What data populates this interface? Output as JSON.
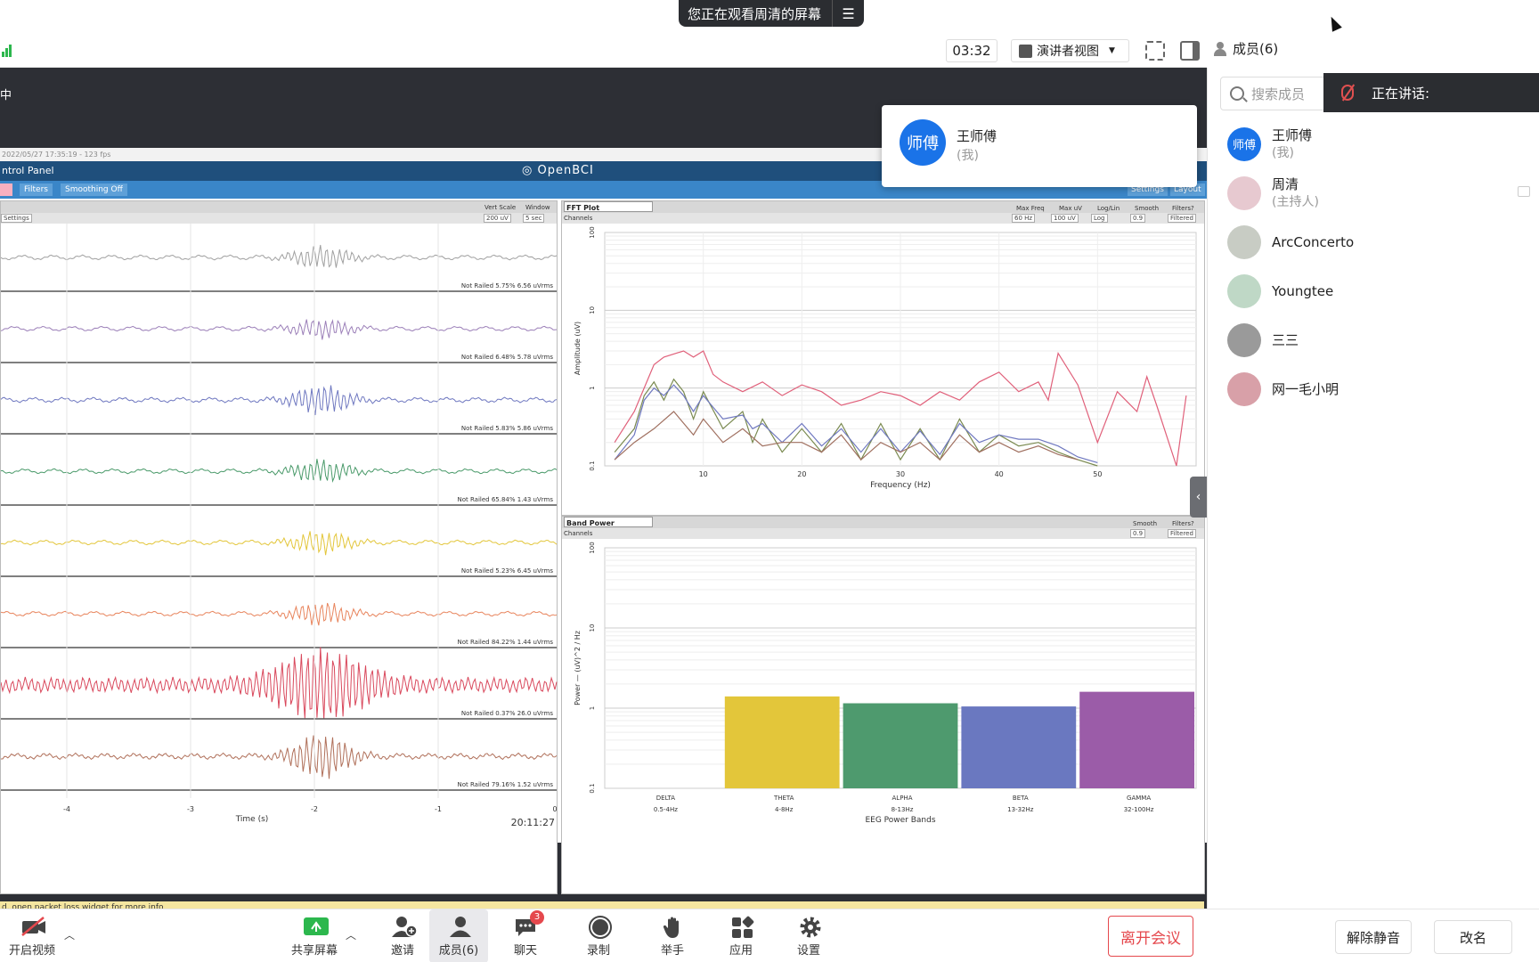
{
  "banner": {
    "text": "您正在观看周清的屏幕",
    "menu_icon": "menu-lines-icon"
  },
  "toolbar": {
    "timer": "03:32",
    "view_mode": "演讲者视图",
    "members_label": "成员(6)"
  },
  "share": {
    "cut_text": "中"
  },
  "openbci": {
    "date_text": "2022/05/27 17:35:19 - 123 fps",
    "header_left": "ntrol Panel",
    "logo": "OpenBCI",
    "buttons": [
      "Filters",
      "Smoothing Off"
    ],
    "right_buttons": [
      "Settings",
      "Layout"
    ],
    "ts_controls": {
      "settings": "Settings",
      "vert_scale_label": "Vert Scale",
      "vert_scale": "200 uV",
      "window_label": "Window",
      "window": "5 sec"
    },
    "ts_channels": [
      {
        "status": "Not Railed 5.75% 6.56 uVrms",
        "color": "#a0a0a0",
        "amp": 0.35
      },
      {
        "status": "Not Railed 6.48% 5.78 uVrms",
        "color": "#9b7fb8",
        "amp": 0.3
      },
      {
        "status": "Not Railed 5.83% 5.86 uVrms",
        "color": "#6f78c0",
        "amp": 0.45
      },
      {
        "status": "Not Railed 65.84% 1.43 uVrms",
        "color": "#4a9a6a",
        "amp": 0.35
      },
      {
        "status": "Not Railed 5.23% 6.45 uVrms",
        "color": "#e3c63a",
        "amp": 0.35
      },
      {
        "status": "Not Railed 84.22% 1.44 uVrms",
        "color": "#e8845c",
        "amp": 0.35
      },
      {
        "status": "Not Railed 0.37% 26.0 uVrms",
        "color": "#d9485c",
        "amp": 1.0
      },
      {
        "status": "Not Railed 79.16% 1.52 uVrms",
        "color": "#b0705a",
        "amp": 0.7
      }
    ],
    "ts_xticks": [
      "-4",
      "-3",
      "-2",
      "-1",
      "0"
    ],
    "ts_xlabel": "Time (s)",
    "ts_clock": "20:11:27",
    "fft_tab": "FFT Plot",
    "channels_label": "Channels",
    "fft_controls": [
      "60 Hz",
      "100 uV",
      "Log",
      "0.9",
      "Filtered"
    ],
    "fft_control_labels": [
      "Max Freq",
      "Max uV",
      "Log/Lin",
      "Smooth",
      "Filters?"
    ],
    "fft_ylabel": "Amplitude (uV)",
    "fft_xlabel": "Frequency (Hz)",
    "fft_yticks": [
      "100",
      "10",
      "1",
      "0.1"
    ],
    "fft_xticks": [
      "10",
      "20",
      "30",
      "40",
      "50"
    ],
    "bp_tab": "Band Power",
    "bp_controls": [
      "0.9",
      "Filtered"
    ],
    "bp_control_labels": [
      "Smooth",
      "Filters?"
    ],
    "bp_ylabel": "Power — (uV)^2 / Hz",
    "bp_xlabel": "EEG Power Bands",
    "bp_yticks": [
      "100",
      "10",
      "1",
      "0.1"
    ],
    "status_text": "d, open packet loss widget for more info"
  },
  "chart_data": [
    {
      "type": "line",
      "title": "FFT Plot",
      "xlabel": "Frequency (Hz)",
      "ylabel": "Amplitude (uV)",
      "xlim": [
        0,
        60
      ],
      "ylim": [
        0.1,
        100
      ],
      "log_y": true,
      "series": [
        {
          "color": "#e0607a",
          "x": [
            1,
            3,
            5,
            6,
            8,
            9,
            10,
            11,
            12,
            14,
            16,
            18,
            20,
            22,
            24,
            26,
            28,
            30,
            32,
            34,
            36,
            38,
            40,
            42,
            44,
            45,
            46,
            48,
            50,
            52,
            54,
            55,
            56,
            58,
            59
          ],
          "y": [
            0.2,
            0.5,
            2,
            2.5,
            3,
            2.5,
            3,
            1.5,
            1.2,
            0.9,
            1.2,
            0.8,
            1.1,
            0.9,
            0.6,
            0.7,
            0.9,
            0.8,
            0.6,
            0.9,
            0.7,
            1.2,
            1.6,
            0.9,
            1.2,
            0.7,
            2.8,
            1.1,
            0.2,
            0.9,
            0.5,
            1.4,
            0.6,
            0.1,
            0.8
          ]
        },
        {
          "color": "#7a8a50",
          "x": [
            1,
            3,
            4,
            5,
            6,
            7,
            8,
            9,
            10,
            12,
            14,
            15,
            16,
            18,
            20,
            22,
            24,
            26,
            28,
            30,
            32,
            34,
            36,
            38,
            40,
            42,
            44,
            46,
            48,
            50
          ],
          "y": [
            0.15,
            0.3,
            0.8,
            1.2,
            0.7,
            1.3,
            0.9,
            0.4,
            0.9,
            0.3,
            0.5,
            0.2,
            0.4,
            0.15,
            0.3,
            0.15,
            0.35,
            0.12,
            0.35,
            0.12,
            0.3,
            0.12,
            0.4,
            0.15,
            0.25,
            0.18,
            0.2,
            0.15,
            0.12,
            0.1
          ]
        },
        {
          "color": "#6f78c0",
          "x": [
            1,
            3,
            4,
            5,
            6,
            7,
            8,
            9,
            10,
            12,
            14,
            15,
            16,
            18,
            20,
            22,
            24,
            26,
            28,
            30,
            32,
            34,
            36,
            38,
            40,
            42,
            44,
            46,
            48,
            50
          ],
          "y": [
            0.12,
            0.25,
            0.7,
            1.0,
            0.8,
            1.1,
            0.8,
            0.5,
            0.8,
            0.4,
            0.45,
            0.3,
            0.35,
            0.2,
            0.35,
            0.18,
            0.3,
            0.15,
            0.3,
            0.15,
            0.28,
            0.14,
            0.35,
            0.2,
            0.25,
            0.22,
            0.22,
            0.18,
            0.13,
            0.11
          ]
        },
        {
          "color": "#a07060",
          "x": [
            1,
            3,
            5,
            7,
            9,
            10,
            12,
            14,
            16,
            18,
            20,
            22,
            24,
            26,
            28,
            30,
            32,
            34,
            36,
            38,
            40,
            42,
            44,
            46,
            48
          ],
          "y": [
            0.12,
            0.2,
            0.3,
            0.5,
            0.25,
            0.4,
            0.2,
            0.3,
            0.18,
            0.2,
            0.2,
            0.15,
            0.25,
            0.12,
            0.2,
            0.15,
            0.2,
            0.12,
            0.25,
            0.15,
            0.2,
            0.15,
            0.18,
            0.14,
            0.12
          ]
        }
      ]
    },
    {
      "type": "bar",
      "title": "Band Power",
      "xlabel": "EEG Power Bands",
      "ylabel": "Power — (uV)^2 / Hz",
      "ylim": [
        0.1,
        100
      ],
      "log_y": true,
      "categories": [
        "DELTA",
        "THETA",
        "ALPHA",
        "BETA",
        "GAMMA"
      ],
      "category_ranges": [
        "0.5-4Hz",
        "4-8Hz",
        "8-13Hz",
        "13-32Hz",
        "32-100Hz"
      ],
      "values": [
        0.1,
        1.4,
        1.15,
        1.05,
        1.6
      ],
      "colors": [
        "#cccccc",
        "#e3c63a",
        "#4e9a6e",
        "#6a78c0",
        "#9b5ca8"
      ]
    }
  ],
  "popup": {
    "avatar": "师傅",
    "name": "王师傅",
    "sub": "(我)"
  },
  "sidebar": {
    "search_placeholder": "搜索成员",
    "speaking_label": "正在讲话:",
    "participants": [
      {
        "name": "王师傅",
        "sub": "(我)",
        "avatar_text": "师傅",
        "avatar_color": "#1a73e8"
      },
      {
        "name": "周清",
        "sub": "(主持人)",
        "avatar_text": "",
        "avatar_color": "#e7c9d0"
      },
      {
        "name": "ArcConcerto",
        "sub": "",
        "avatar_text": "",
        "avatar_color": "#c8ccc4"
      },
      {
        "name": "Youngtee",
        "sub": "",
        "avatar_text": "",
        "avatar_color": "#bfd8c6"
      },
      {
        "name": "三三",
        "sub": "",
        "avatar_text": "",
        "avatar_color": "#9a9a9a"
      },
      {
        "name": "网一毛小明",
        "sub": "",
        "avatar_text": "",
        "avatar_color": "#d8a0a8"
      }
    ]
  },
  "bottom": {
    "video": "开启视频",
    "share": "共享屏幕",
    "invite": "邀请",
    "members": "成员(6)",
    "chat": "聊天",
    "chat_badge": "3",
    "record": "录制",
    "raise": "举手",
    "apps": "应用",
    "settings": "设置",
    "leave": "离开会议",
    "unmute": "解除静音",
    "rename": "改名"
  }
}
